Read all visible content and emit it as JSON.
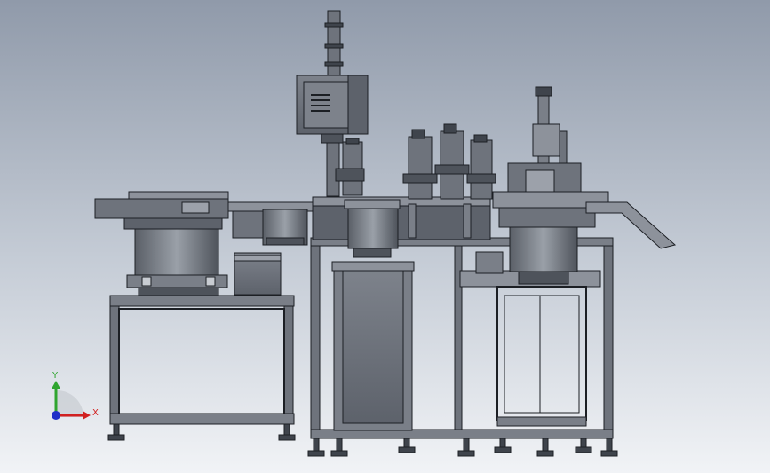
{
  "triad": {
    "y_label": "Y",
    "x_label": "X",
    "y_color": "#2fa52f",
    "x_color": "#d12020",
    "z_color": "#2030c8"
  },
  "colors": {
    "frame": "#7a7f88",
    "frame_dark": "#3f444c",
    "panel": "#6e737c",
    "panel_light": "#9ca1aa",
    "edge": "#1c1f24"
  }
}
